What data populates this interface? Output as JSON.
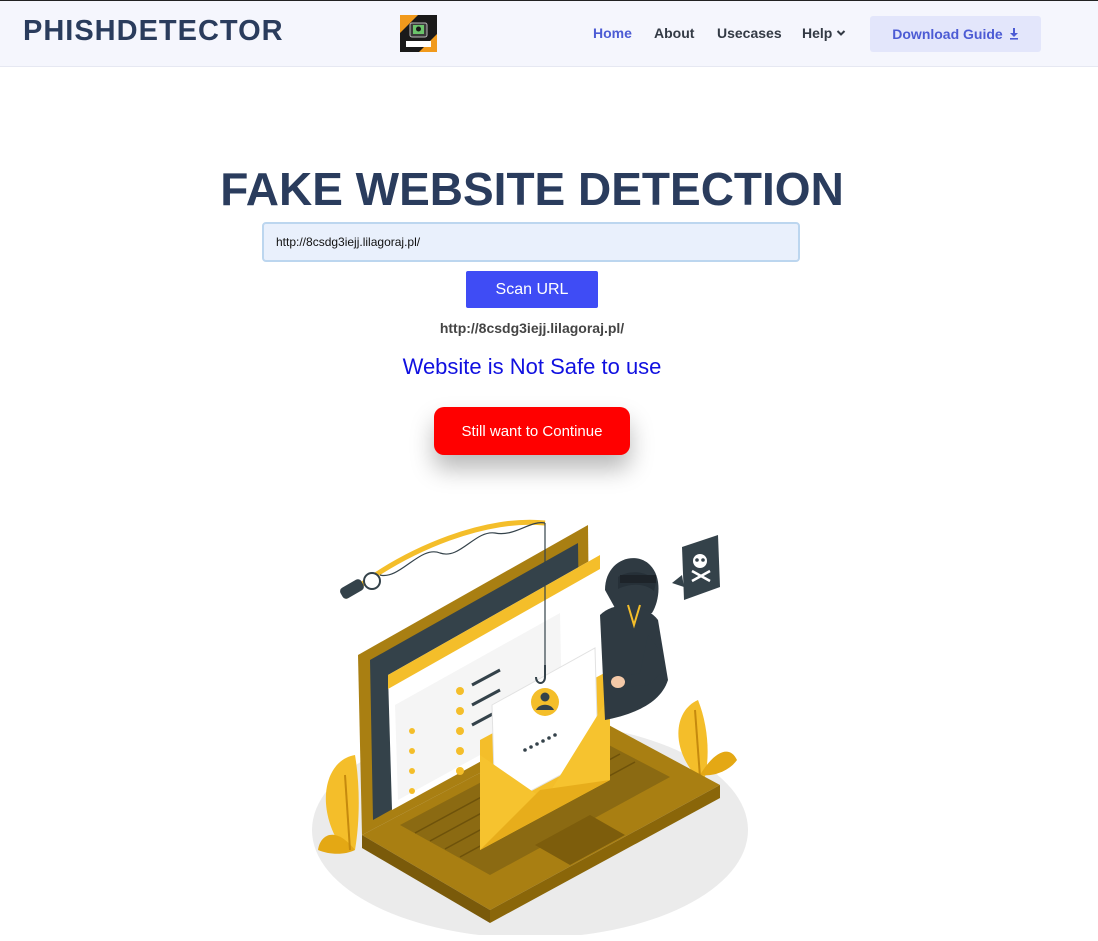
{
  "navbar": {
    "brand": "PHISHDETECTOR",
    "logo_alt": "PHISH DETECTOR logo",
    "links": {
      "home": "Home",
      "about": "About",
      "usecases": "Usecases",
      "help": "Help"
    },
    "download_label": "Download Guide",
    "active_link": "home"
  },
  "main": {
    "title": "FAKE WEBSITE DETECTION",
    "url_value": "http://8csdg3iejj.lilagoraj.pl/",
    "scan_label": "Scan URL",
    "result_url": "http://8csdg3iejj.lilagoraj.pl/",
    "verdict": "Website is Not Safe to use",
    "continue_label": "Still want to Continue"
  },
  "icons": {
    "help_dropdown": "chevron-down-icon",
    "download": "download-icon",
    "warning": "skull-crossbones-icon"
  },
  "colors": {
    "brand": "#2a3c5d",
    "accent": "#4c5bd4",
    "scan_button": "#3f4cf5",
    "danger": "#ff0000",
    "verdict": "#1010e0"
  }
}
